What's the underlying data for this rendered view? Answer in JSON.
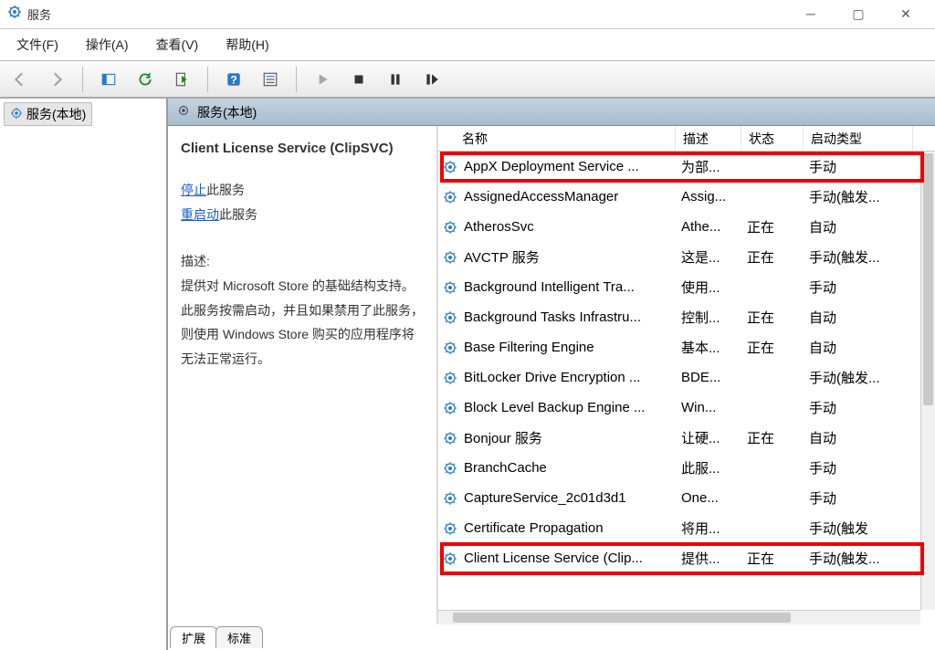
{
  "window": {
    "title": "服务"
  },
  "menu": {
    "file": "文件(F)",
    "action": "操作(A)",
    "view": "查看(V)",
    "help": "帮助(H)"
  },
  "tree": {
    "root": "服务(本地)"
  },
  "content_header": "服务(本地)",
  "detail": {
    "title": "Client License Service (ClipSVC)",
    "stop_link": "停止",
    "stop_suffix": "此服务",
    "restart_link": "重启动",
    "restart_suffix": "此服务",
    "desc_label": "描述:",
    "desc_text": "提供对 Microsoft Store 的基础结构支持。此服务按需启动，并且如果禁用了此服务，则使用 Windows Store 购买的应用程序将无法正常运行。"
  },
  "columns": {
    "name": "名称",
    "desc": "描述",
    "status": "状态",
    "startup": "启动类型"
  },
  "rows": [
    {
      "name": "AppX Deployment Service ...",
      "desc": "为部...",
      "status": "",
      "startup": "手动",
      "hl": true
    },
    {
      "name": "AssignedAccessManager",
      "desc": "Assig...",
      "status": "",
      "startup": "手动(触发..."
    },
    {
      "name": "AtherosSvc",
      "desc": "Athe...",
      "status": "正在",
      "startup": "自动"
    },
    {
      "name": "AVCTP 服务",
      "desc": "这是...",
      "status": "正在",
      "startup": "手动(触发..."
    },
    {
      "name": "Background Intelligent Tra...",
      "desc": "使用...",
      "status": "",
      "startup": "手动"
    },
    {
      "name": "Background Tasks Infrastru...",
      "desc": "控制...",
      "status": "正在",
      "startup": "自动"
    },
    {
      "name": "Base Filtering Engine",
      "desc": "基本...",
      "status": "正在",
      "startup": "自动"
    },
    {
      "name": "BitLocker Drive Encryption ...",
      "desc": "BDE...",
      "status": "",
      "startup": "手动(触发..."
    },
    {
      "name": "Block Level Backup Engine ...",
      "desc": "Win...",
      "status": "",
      "startup": "手动"
    },
    {
      "name": "Bonjour 服务",
      "desc": "让硬...",
      "status": "正在",
      "startup": "自动"
    },
    {
      "name": "BranchCache",
      "desc": "此服...",
      "status": "",
      "startup": "手动"
    },
    {
      "name": "CaptureService_2c01d3d1",
      "desc": "One...",
      "status": "",
      "startup": "手动"
    },
    {
      "name": "Certificate Propagation",
      "desc": "将用...",
      "status": "",
      "startup": "手动(触发"
    },
    {
      "name": "Client License Service (Clip...",
      "desc": "提供...",
      "status": "正在",
      "startup": "手动(触发...",
      "hl": true,
      "sel": true
    }
  ],
  "tabs": {
    "ext": "扩展",
    "std": "标准"
  }
}
